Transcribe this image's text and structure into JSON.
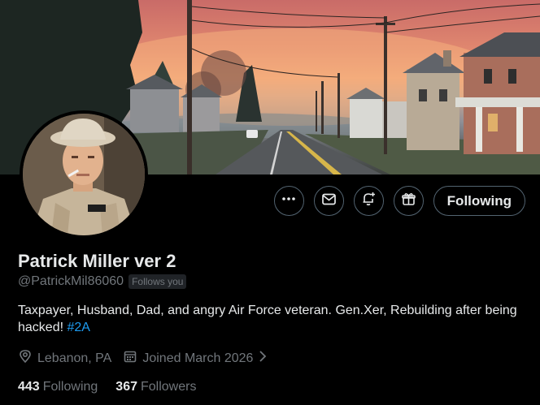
{
  "profile": {
    "name": "Patrick Miller ver 2",
    "handle": "@PatrickMil86060",
    "follows_you_badge": "Follows you",
    "bio_text": "Taxpayer, Husband, Dad, and angry Air Force veteran. Gen.Xer, Rebuilding after being hacked!",
    "bio_hashtag": "#2A",
    "location": "Lebanon, PA",
    "joined": "Joined March 2026",
    "following_count": "443",
    "following_label": "Following",
    "followers_count": "367",
    "followers_label": "Followers"
  },
  "actions": {
    "more_icon": "more-icon",
    "message_icon": "envelope-icon",
    "notify_icon": "bell-plus-icon",
    "gift_icon": "gift-icon",
    "following_button_label": "Following"
  },
  "colors": {
    "background": "#000000",
    "text_primary": "#e7e9ea",
    "text_secondary": "#71767b",
    "accent": "#1d9bf0",
    "button_border": "#536471"
  }
}
